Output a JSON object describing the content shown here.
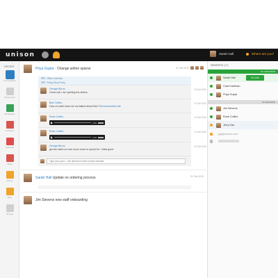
{
  "app": {
    "logo": "unison"
  },
  "header": {
    "user_name": "Sarah Hall",
    "status_text": "Where are you?"
  },
  "sidebar": {
    "top_label": "RECENT",
    "items": [
      {
        "label": "Conversation",
        "icon": "chat-icon",
        "color": "#2d7fc1"
      },
      {
        "label": "Documents",
        "icon": "doc-icon",
        "color": "#cfcfcf"
      },
      {
        "label": "Workspace",
        "icon": "workspace-icon",
        "color": "#3aa15a"
      },
      {
        "label": "Contacts",
        "icon": "contacts-icon",
        "color": "#d9534f"
      },
      {
        "label": "Calendar",
        "icon": "calendar-icon",
        "color": "#e04a4a"
      },
      {
        "label": "Tasks",
        "icon": "tasks-icon",
        "color": "#d9534f"
      },
      {
        "label": "Phone",
        "icon": "phone-icon",
        "color": "#f0a32a"
      },
      {
        "label": "Files",
        "icon": "files-icon",
        "color": "#f0a32a"
      },
      {
        "label": "Groups",
        "icon": "groups-icon",
        "color": "#cfcfcf"
      }
    ]
  },
  "posts": [
    {
      "author": "Priya Gupta",
      "title": "Change airline sparse",
      "date": "21 Oct 2012",
      "tags": [
        "Office interests",
        "Friday Boat Party"
      ],
      "comments": [
        {
          "name": "George Burns",
          "text": "Great call, I am spelling the airfare.",
          "link": "",
          "date": "12 Oct 2012",
          "audio": ""
        },
        {
          "name": "Bob Collins",
          "text": "How on earth have we not talked about this? ",
          "link": "Recommended site",
          "date": "12 Oct 2012",
          "audio": ""
        },
        {
          "name": "Rose Collins",
          "text": "",
          "link": "",
          "date": "12 Oct 2012",
          "audio": "0:00"
        },
        {
          "name": "Rose Collins",
          "text": "",
          "link": "",
          "date": "12 Oct 2012",
          "audio": "0:00"
        },
        {
          "name": "George Burns",
          "text": "got the client on how much more to spend for. I think good",
          "link": "",
          "date": "12 Oct 2012",
          "audio": ""
        }
      ],
      "reply_placeholder": "Type your post... Use @name to alert a team member"
    },
    {
      "author": "Sarah Hall",
      "title": "Update on ordering process",
      "date": "21 Oct 2012"
    },
    {
      "author": "Jim Stevens",
      "title": "new staff onboarding",
      "date": ""
    }
  ],
  "right_panel": {
    "header": "MEMBERS (17)",
    "band_online": "IN THIS ROOM",
    "band_elsewhere": "ELSEWHERE",
    "online": [
      {
        "name": "Sarah Hall",
        "status": "green"
      },
      {
        "name": "Cara Kaufman",
        "status": "green"
      },
      {
        "name": "Priya Gupta",
        "status": "green"
      }
    ],
    "go_live": "Go Live",
    "elsewhere": [
      {
        "name": "Jim Stevens",
        "status": "green"
      },
      {
        "name": "Rose Collins",
        "status": "green"
      },
      {
        "name": "Jerry Kao",
        "status": "orange"
      }
    ],
    "invite_text": "jpg@unison.com"
  }
}
